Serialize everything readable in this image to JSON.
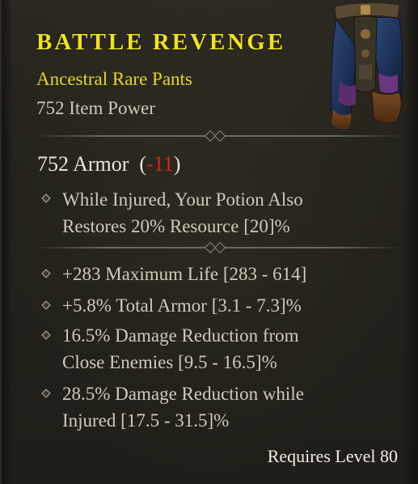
{
  "item": {
    "name": "BATTLE REVENGE",
    "type_line": "Ancestral Rare Pants",
    "item_power": "752 Item Power",
    "armor": {
      "value_text": "752 Armor",
      "open_paren": "(",
      "delta": "-11",
      "close_paren": ")"
    },
    "implicit_affixes": [
      {
        "line1": "While Injured, Your Potion Also",
        "line2": "Restores 20% Resource [20]%"
      }
    ],
    "affixes": [
      {
        "line1": "+283 Maximum Life [283 - 614]"
      },
      {
        "line1": "+5.8% Total Armor [3.1 - 7.3]%"
      },
      {
        "line1": "16.5% Damage Reduction from",
        "line2": "Close Enemies [9.5 - 16.5]%"
      },
      {
        "line1": "28.5% Damage Reduction while",
        "line2": "Injured [17.5 - 31.5]%"
      }
    ],
    "requirement": "Requires Level 80",
    "image_icon": "pants-icon"
  },
  "colors": {
    "rare_yellow": "#f1e31a",
    "armor_negative": "#d8231b",
    "text_body": "#cfcabb",
    "background": "#23221b"
  }
}
